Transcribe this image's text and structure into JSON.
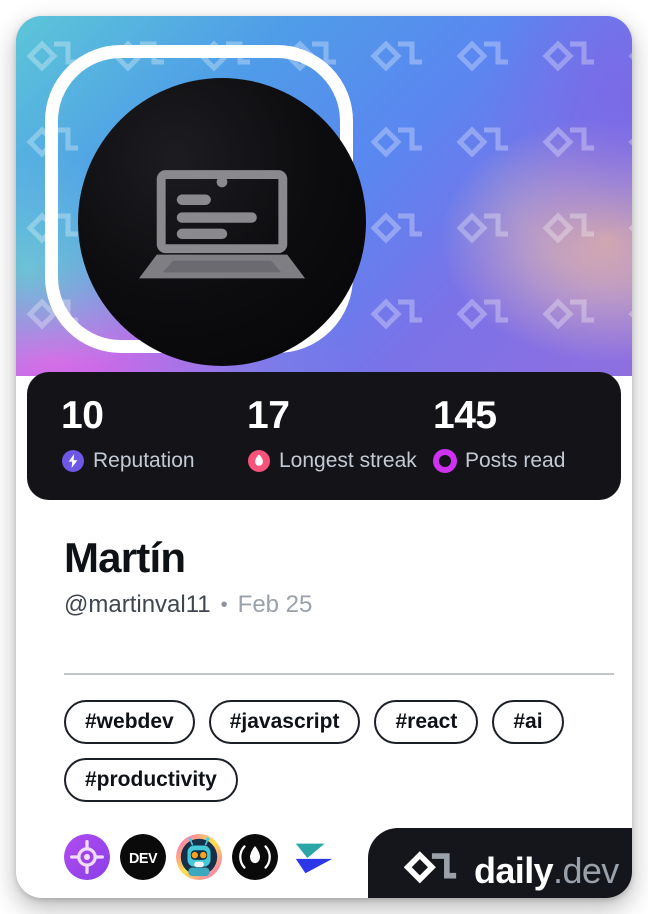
{
  "card": {
    "type": "devcard",
    "theme_colors": {
      "stats_bg": "#131318",
      "badge_bg": "#15161c",
      "text_primary": "#0e1217",
      "text_muted": "#9aa1ab",
      "reputation": "#6f57e6",
      "streak": "#f8537b",
      "posts_read": "#cf31f0"
    }
  },
  "cover": {
    "watermark": "daily-dev-logo-pattern",
    "gradient": [
      "#5cc6d8",
      "#4f9de8",
      "#5a86f0",
      "#7b72e8",
      "#8f6fe0",
      "#e960e8",
      "#fac496"
    ]
  },
  "avatar": {
    "icon": "laptop-icon",
    "alt": "Martín avatar"
  },
  "stats": [
    {
      "value": "10",
      "label": "Reputation",
      "icon": "bolt-icon",
      "color": "#6f57e6"
    },
    {
      "value": "17",
      "label": "Longest streak",
      "icon": "flame-icon",
      "color": "#f8537b"
    },
    {
      "value": "145",
      "label": "Posts read",
      "icon": "ring-icon",
      "color": "#cf31f0"
    }
  ],
  "identity": {
    "name": "Martín",
    "handle": "@martinval11",
    "separator": "•",
    "date": "Feb 25"
  },
  "tags": [
    {
      "label": "#webdev"
    },
    {
      "label": "#javascript"
    },
    {
      "label": "#react"
    },
    {
      "label": "#ai"
    },
    {
      "label": "#productivity"
    }
  ],
  "sources": [
    {
      "name": "target-crosshair-icon",
      "title": "source-1"
    },
    {
      "name": "dev-to-icon",
      "title": "DEV",
      "text": "DEV"
    },
    {
      "name": "robot-avatar-icon",
      "title": "source-3"
    },
    {
      "name": "flame-circle-icon",
      "title": "source-4"
    },
    {
      "name": "send-arrow-icon",
      "title": "source-5"
    }
  ],
  "badge": {
    "logo": "daily-dev-logo",
    "word_main": "daily",
    "word_suffix": ".dev"
  }
}
